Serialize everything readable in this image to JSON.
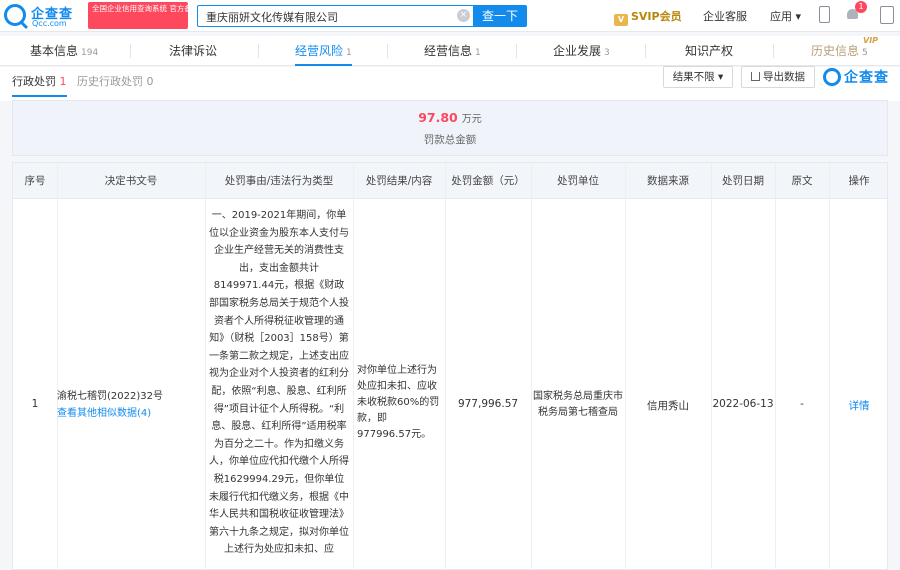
{
  "topbar": {
    "logo_cn": "企查查",
    "logo_en": "Qcc.com",
    "badge_text": "全国企业信用查询系统 官方备案企业征信机构",
    "search_value": "重庆丽妍文化传媒有限公司",
    "clear_glyph": "×",
    "search_button": "查一下",
    "crown_glyph": "V",
    "svip_label": "SVIP会员",
    "service_label": "企业客服",
    "app_label": "应用 ▾",
    "notification_count": "1"
  },
  "nav": {
    "tabs": [
      {
        "label": "基本信息",
        "count": "194"
      },
      {
        "label": "法律诉讼",
        "count": ""
      },
      {
        "label": "经营风险",
        "count": "1"
      },
      {
        "label": "经营信息",
        "count": "1"
      },
      {
        "label": "企业发展",
        "count": "3"
      },
      {
        "label": "知识产权",
        "count": ""
      },
      {
        "label": "历史信息",
        "count": "5"
      }
    ],
    "vip_tag": "VIP"
  },
  "subnav": {
    "active_label": "行政处罚",
    "active_count": "1",
    "inactive_label": "历史行政处罚 0",
    "filter_label": "结果不限 ▾",
    "export_label": "导出数据",
    "brand": "企查查"
  },
  "summary": {
    "amount": "97.80",
    "unit": "万元",
    "label": "罚款总金额"
  },
  "table": {
    "headers": [
      "序号",
      "决定书文号",
      "处罚事由/违法行为类型",
      "处罚结果/内容",
      "处罚金额（元）",
      "处罚单位",
      "数据来源",
      "处罚日期",
      "原文",
      "操作"
    ],
    "rows": [
      {
        "index": "1",
        "doc_number": "渝税七稽罚(2022)32号",
        "doc_link": "查看其他相似数据(4)",
        "reason": "一、2019-2021年期间，你单位以企业资金为股东本人支付与企业生产经营无关的消费性支出，支出金额共计8149971.44元，根据《财政部国家税务总局关于规范个人投资者个人所得税征收管理的通知》（财税［2003］158号）第一条第二款之规定，上述支出应视为企业对个人投资者的红利分配，依照“利息、股息、红利所得”项目计征个人所得税。“利息、股息、红利所得”适用税率为百分之二十。作为扣缴义务人，你单位应代扣代缴个人所得税1629994.29元，但你单位未履行代扣代缴义务，根据《中华人民共和国税收征收管理法》第六十九条之规定，拟对你单位上述行为处应扣未扣、应",
        "result": "对你单位上述行为处应扣未扣、应收未收税款60%的罚款，即977996.57元。",
        "amount": "977,996.57",
        "authority": "国家税务总局重庆市税务局第七稽查局",
        "source": "信用秀山",
        "date": "2022-06-13",
        "original": "-",
        "action": "详情"
      }
    ]
  }
}
